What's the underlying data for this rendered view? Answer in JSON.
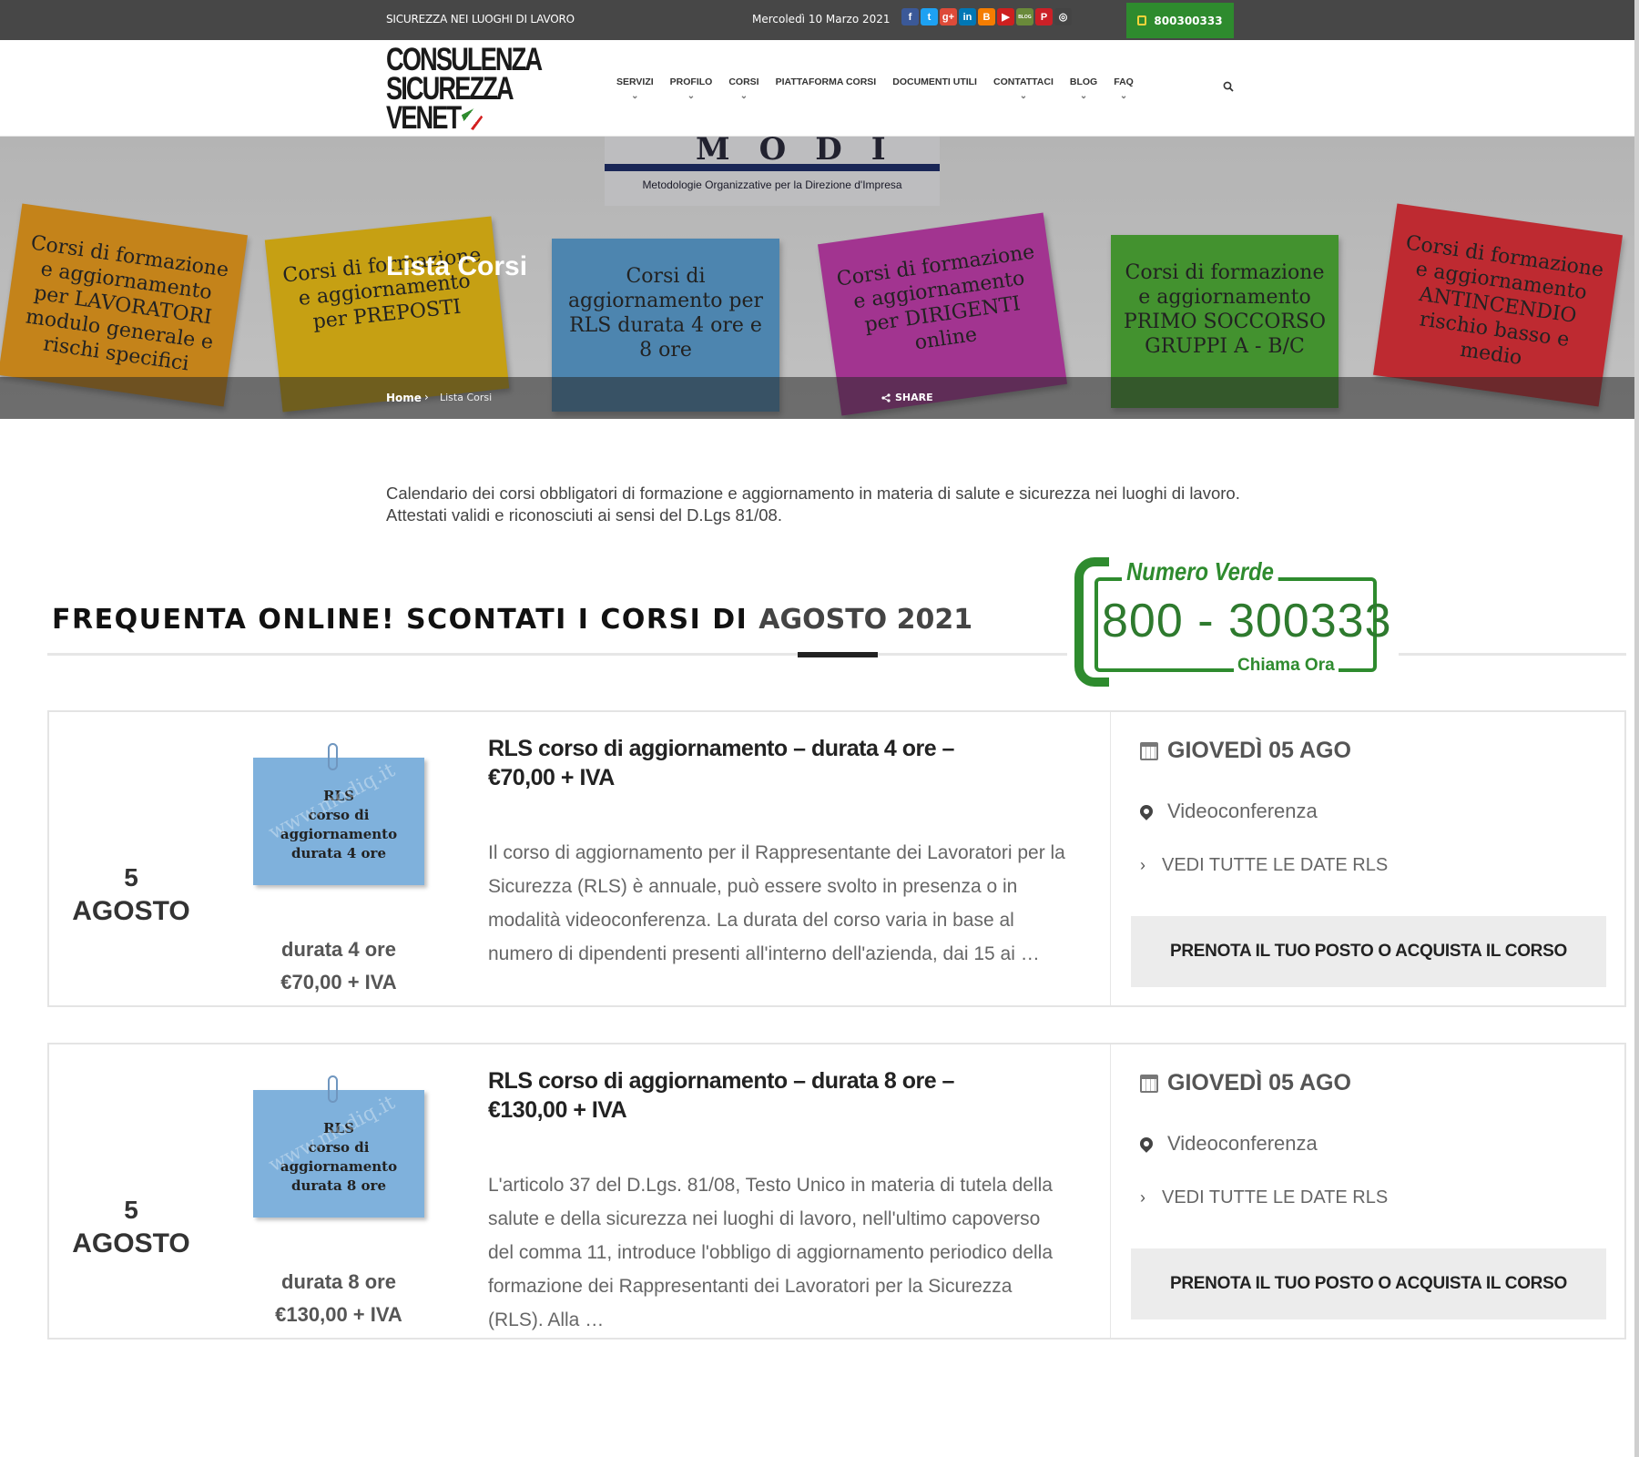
{
  "topbar": {
    "tagline": "SICUREZZA NEI LUOGHI DI LAVORO",
    "date": "Mercoledì 10 Marzo 2021",
    "phone": "800300333",
    "socials": [
      {
        "name": "facebook-icon",
        "glyph": "f",
        "color": "#3b5998"
      },
      {
        "name": "twitter-icon",
        "glyph": "t",
        "color": "#1da1f2"
      },
      {
        "name": "google-plus-icon",
        "glyph": "g+",
        "color": "#dd4b39"
      },
      {
        "name": "linkedin-icon",
        "glyph": "in",
        "color": "#0077b5"
      },
      {
        "name": "blogger-icon",
        "glyph": "B",
        "color": "#f57d00"
      },
      {
        "name": "youtube-icon",
        "glyph": "▶",
        "color": "#cd201f"
      },
      {
        "name": "blog-icon",
        "glyph": "BLOG",
        "color": "#6a8a3a"
      },
      {
        "name": "pinterest-icon",
        "glyph": "P",
        "color": "#cb2027"
      },
      {
        "name": "instagram-icon",
        "glyph": "◎",
        "color": "#444444"
      }
    ]
  },
  "header": {
    "logo_lines": [
      "CONSULENZA",
      "SICUREZZA",
      "VENET"
    ],
    "nav": [
      {
        "label": "SERVIZI",
        "dropdown": true
      },
      {
        "label": "PROFILO",
        "dropdown": true
      },
      {
        "label": "CORSI",
        "dropdown": true
      },
      {
        "label": "PIATTAFORMA CORSI",
        "dropdown": false
      },
      {
        "label": "DOCUMENTI UTILI",
        "dropdown": false
      },
      {
        "label": "CONTATTACI",
        "dropdown": true
      },
      {
        "label": "BLOG",
        "dropdown": true
      },
      {
        "label": "FAQ",
        "dropdown": true
      }
    ]
  },
  "hero": {
    "modi_letters": "MODI",
    "modi_sub": "Metodologie Organizzative per la Direzione d'Impresa",
    "title": "Lista Corsi",
    "notes": [
      {
        "text": "Corsi di formazione e aggiornamento per LAVORATORI modulo generale e rischi specifici",
        "color": "#f0a020"
      },
      {
        "text": "Corsi di formazione e aggiornamento per PREPOSTI",
        "color": "#f2c418"
      },
      {
        "text": "Corsi di aggiornamento per RLS durata 4 ore e 8 ore",
        "color": "#5ea3d6"
      },
      {
        "text": "Corsi di formazione e aggiornamento per DIRIGENTI online",
        "color": "#c640b0"
      },
      {
        "text": "Corsi di formazione e aggiornamento PRIMO SOCCORSO GRUPPI A - B/C",
        "color": "#52b33a"
      },
      {
        "text": "Corsi di formazione e aggiornamento ANTINCENDIO rischio basso e medio",
        "color": "#e8343c"
      }
    ],
    "breadcrumb_home": "Home",
    "breadcrumb_sep": "›",
    "breadcrumb_current": "Lista Corsi",
    "share": "SHARE"
  },
  "intro": "Calendario dei corsi obbligatori di formazione e aggiornamento in materia di salute e sicurezza nei luoghi di lavoro. Attestati validi e riconosciuti ai sensi del D.Lgs 81/08.",
  "promo": {
    "text": "FREQUENTA ONLINE! SCONTATI I CORSI DI ",
    "highlight": "AGOSTO 2021"
  },
  "numero_verde": {
    "title": "Numero Verde",
    "number": "800 - 300333",
    "call": "Chiama Ora"
  },
  "events": [
    {
      "day": "5",
      "month": "AGOSTO",
      "thumb_text": [
        "RLS",
        "corso di",
        "aggiornamento",
        "durata 4 ore"
      ],
      "watermark": "www.modiq.it",
      "duration": "durata 4 ore",
      "price": "€70,00 + IVA",
      "title": "RLS corso di aggiornamento – durata 4 ore – €70,00 + IVA",
      "description": "Il corso di aggiornamento per il Rappresentante dei Lavoratori per la Sicurezza (RLS) è annuale, può essere svolto in presenza o in modalità videoconferenza. La durata del corso varia in base al numero di dipendenti presenti all'interno dell'azienda, dai 15 ai …",
      "date": "GIOVEDÌ 05 AGO",
      "location": "Videoconferenza",
      "all_dates": "VEDI TUTTE LE DATE RLS",
      "cta": "PRENOTA IL TUO POSTO O ACQUISTA IL CORSO"
    },
    {
      "day": "5",
      "month": "AGOSTO",
      "thumb_text": [
        "RLS",
        "corso di",
        "aggiornamento",
        "durata 8 ore"
      ],
      "watermark": "www.modiq.it",
      "duration": "durata 8 ore",
      "price": "€130,00 + IVA",
      "title": "RLS corso di aggiornamento – durata 8 ore – €130,00 + IVA",
      "description": "L'articolo 37 del D.Lgs. 81/08, Testo Unico in materia di tutela della salute e della sicurezza nei luoghi di lavoro, nell'ultimo capoverso del comma 11, introduce l'obbligo di aggiornamento periodico della formazione dei Rappresentanti dei Lavoratori per la Sicurezza (RLS). Alla …",
      "date": "GIOVEDÌ 05 AGO",
      "location": "Videoconferenza",
      "all_dates": "VEDI TUTTE LE DATE RLS",
      "cta": "PRENOTA IL TUO POSTO O ACQUISTA IL CORSO"
    }
  ]
}
